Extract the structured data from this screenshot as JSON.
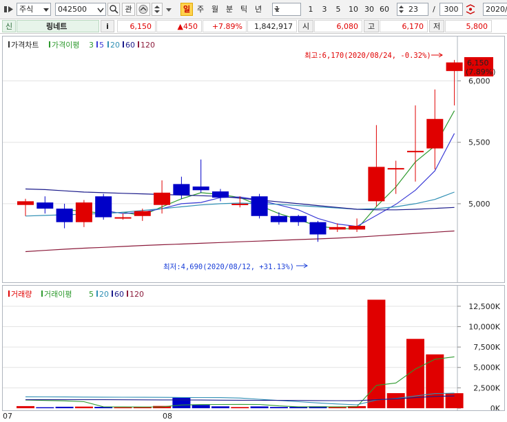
{
  "toolbar": {
    "market": "주식",
    "code": "042500",
    "btn_watch": "관",
    "period_tabs": [
      "일",
      "주",
      "월",
      "분",
      "틱",
      "년"
    ],
    "active_tab": "일",
    "interval_value": "1",
    "interval_presets": [
      "1",
      "3",
      "5",
      "10",
      "30",
      "60"
    ],
    "count_value": "23",
    "slash": "/",
    "total_value": "300",
    "date_value": "2020/"
  },
  "quote": {
    "market_badge": "신",
    "name": "링네트",
    "info": "i",
    "price": "6,150",
    "change": "▲450",
    "change_pct": "+7.89%",
    "volume": "1,842,917",
    "open_label": "시",
    "open": "6,080",
    "high_label": "고",
    "high": "6,170",
    "low_label": "저",
    "low": "5,800"
  },
  "price_legend": {
    "title": "가격차트",
    "ma_title": "가격이평",
    "periods": [
      "3",
      "5",
      "20",
      "60",
      "120"
    ]
  },
  "volume_legend": {
    "title": "거래량",
    "ma_title": "거래이평",
    "periods": [
      "5",
      "20",
      "60",
      "120"
    ]
  },
  "annotations": {
    "high": "최고:6,170(2020/08/24, -0.32%)",
    "low": "최저:4,690(2020/08/12, +31.13%)",
    "current_price": "6,150",
    "current_pct": "(7.89%)"
  },
  "colors": {
    "up": "#e00000",
    "down": "#0000c8",
    "ma3": "#2e9a2e",
    "ma5": "#3b3bd6",
    "ma20": "#2f8fb4",
    "ma60": "#1a1a8a",
    "ma120": "#8b1a3a"
  },
  "chart_data": [
    {
      "type": "candlestick",
      "title": "가격차트",
      "ylim": [
        4400,
        6350
      ],
      "yticks": [
        "5,000",
        "5,500",
        "6,000"
      ],
      "ytick_values": [
        5000,
        5500,
        6000
      ],
      "xlabels": [
        "07",
        "08"
      ],
      "candles": [
        {
          "o": 4990,
          "h": 5040,
          "l": 4900,
          "c": 5020
        },
        {
          "o": 5010,
          "h": 5060,
          "l": 4920,
          "c": 4960
        },
        {
          "o": 4960,
          "h": 5000,
          "l": 4800,
          "c": 4850
        },
        {
          "o": 4850,
          "h": 5030,
          "l": 4810,
          "c": 5010
        },
        {
          "o": 5060,
          "h": 5080,
          "l": 4870,
          "c": 4890
        },
        {
          "o": 4890,
          "h": 4920,
          "l": 4870,
          "c": 4890
        },
        {
          "o": 4900,
          "h": 4960,
          "l": 4860,
          "c": 4940
        },
        {
          "o": 4990,
          "h": 5190,
          "l": 4920,
          "c": 5090
        },
        {
          "o": 5160,
          "h": 5220,
          "l": 5040,
          "c": 5070
        },
        {
          "o": 5140,
          "h": 5360,
          "l": 5090,
          "c": 5110
        },
        {
          "o": 5100,
          "h": 5120,
          "l": 5020,
          "c": 5050
        },
        {
          "o": 5000,
          "h": 5060,
          "l": 4970,
          "c": 5000
        },
        {
          "o": 5060,
          "h": 5080,
          "l": 4880,
          "c": 4900
        },
        {
          "o": 4900,
          "h": 4930,
          "l": 4830,
          "c": 4850
        },
        {
          "o": 4900,
          "h": 4910,
          "l": 4820,
          "c": 4850
        },
        {
          "o": 4850,
          "h": 4860,
          "l": 4690,
          "c": 4750
        },
        {
          "o": 4790,
          "h": 4840,
          "l": 4770,
          "c": 4810
        },
        {
          "o": 4790,
          "h": 4880,
          "l": 4770,
          "c": 4820
        },
        {
          "o": 5020,
          "h": 5640,
          "l": 4980,
          "c": 5300
        },
        {
          "o": 5280,
          "h": 5350,
          "l": 5080,
          "c": 5290
        },
        {
          "o": 5420,
          "h": 5800,
          "l": 5180,
          "c": 5430
        },
        {
          "o": 5450,
          "h": 5930,
          "l": 5280,
          "c": 5690
        },
        {
          "o": 6080,
          "h": 6170,
          "l": 5800,
          "c": 6150
        }
      ],
      "series": [
        {
          "name": "3",
          "values": [
            null,
            null,
            4950,
            4940,
            4920,
            4930,
            4905,
            4975,
            5040,
            5090,
            5075,
            5050,
            4985,
            4920,
            4870,
            4817,
            4800,
            4793,
            4977,
            5137,
            5340,
            5470,
            5757
          ]
        },
        {
          "name": "5",
          "values": [
            null,
            null,
            null,
            null,
            4945,
            4920,
            4930,
            4960,
            5000,
            5010,
            5050,
            5055,
            5030,
            4990,
            4950,
            4880,
            4835,
            4815,
            4905,
            4995,
            5110,
            5268,
            5572
          ]
        },
        {
          "name": "20",
          "values": [
            4900,
            4905,
            4910,
            4915,
            4920,
            4930,
            4945,
            4960,
            4975,
            4990,
            5000,
            5005,
            5000,
            4995,
            4985,
            4975,
            4965,
            4955,
            4960,
            4975,
            5000,
            5035,
            5095
          ]
        },
        {
          "name": "60",
          "values": [
            5120,
            5115,
            5105,
            5095,
            5090,
            5085,
            5080,
            5075,
            5070,
            5065,
            5060,
            5045,
            5030,
            5015,
            5000,
            4985,
            4970,
            4955,
            4950,
            4950,
            4955,
            4962,
            4970
          ]
        },
        {
          "name": "120",
          "values": [
            4610,
            4620,
            4630,
            4638,
            4645,
            4652,
            4660,
            4666,
            4672,
            4678,
            4684,
            4690,
            4696,
            4702,
            4708,
            4714,
            4720,
            4728,
            4738,
            4748,
            4758,
            4768,
            4778
          ]
        }
      ]
    },
    {
      "type": "bar",
      "title": "거래량",
      "ylim": [
        0,
        13500
      ],
      "yticks": [
        "0K",
        "2,500K",
        "5,000K",
        "7,500K",
        "10,000K",
        "12,500K"
      ],
      "ytick_values": [
        0,
        2500,
        5000,
        7500,
        10000,
        12500
      ],
      "values": [
        260,
        120,
        180,
        200,
        170,
        110,
        120,
        280,
        1300,
        400,
        230,
        140,
        220,
        150,
        160,
        230,
        120,
        260,
        13300,
        1850,
        8500,
        6600,
        1843
      ],
      "series": [
        {
          "name": "5",
          "values": [
            1000,
            950,
            900,
            800,
            180,
            160,
            150,
            170,
            400,
            450,
            460,
            470,
            460,
            290,
            180,
            180,
            180,
            190,
            2800,
            3100,
            4800,
            6000,
            6300
          ]
        },
        {
          "name": "20",
          "values": [
            1400,
            1390,
            1380,
            1370,
            1360,
            1350,
            1340,
            1330,
            1320,
            1310,
            1300,
            1250,
            1100,
            950,
            800,
            650,
            520,
            420,
            1000,
            1200,
            1500,
            1800,
            1850
          ]
        },
        {
          "name": "60",
          "values": [
            1050,
            1050,
            1050,
            1050,
            1050,
            1040,
            1030,
            1020,
            1010,
            1000,
            990,
            980,
            970,
            960,
            950,
            940,
            930,
            920,
            1050,
            1150,
            1300,
            1450,
            1500
          ]
        }
      ]
    }
  ]
}
